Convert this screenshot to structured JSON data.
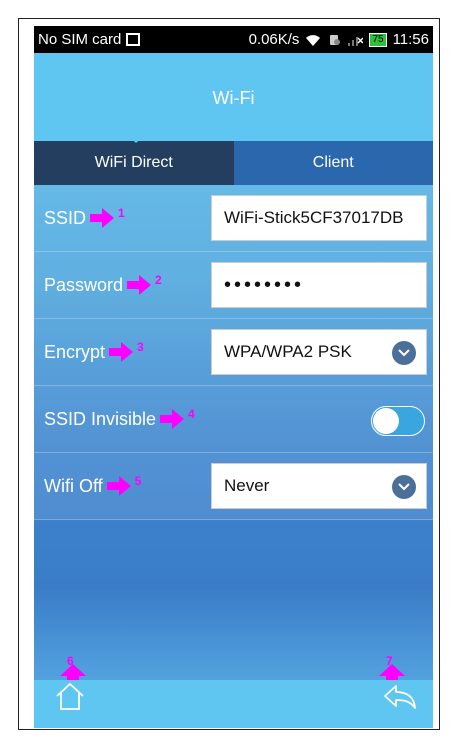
{
  "status_bar": {
    "carrier": "No SIM card",
    "speed": "0.06K/s",
    "battery": "75",
    "time": "11:56"
  },
  "header": {
    "title": "Wi-Fi"
  },
  "tabs": [
    {
      "label": "WiFi Direct",
      "active": true
    },
    {
      "label": "Client",
      "active": false
    }
  ],
  "form": {
    "ssid": {
      "label": "SSID",
      "value": "WiFi-Stick5CF37017DB",
      "marker": "1"
    },
    "password": {
      "label": "Password",
      "value": "••••••••",
      "marker": "2"
    },
    "encrypt": {
      "label": "Encrypt",
      "value": "WPA/WPA2 PSK",
      "marker": "3"
    },
    "ssid_invisible": {
      "label": "SSID Invisible",
      "enabled": false,
      "marker": "4"
    },
    "wifi_off": {
      "label": "Wifi Off",
      "value": "Never",
      "marker": "5"
    }
  },
  "bottom": {
    "home_marker": "6",
    "back_marker": "7"
  },
  "colors": {
    "accent": "#5ec6f0",
    "tab_active": "#233e5e",
    "tab_inactive": "#2a67ac",
    "marker": "#ff00ff"
  }
}
